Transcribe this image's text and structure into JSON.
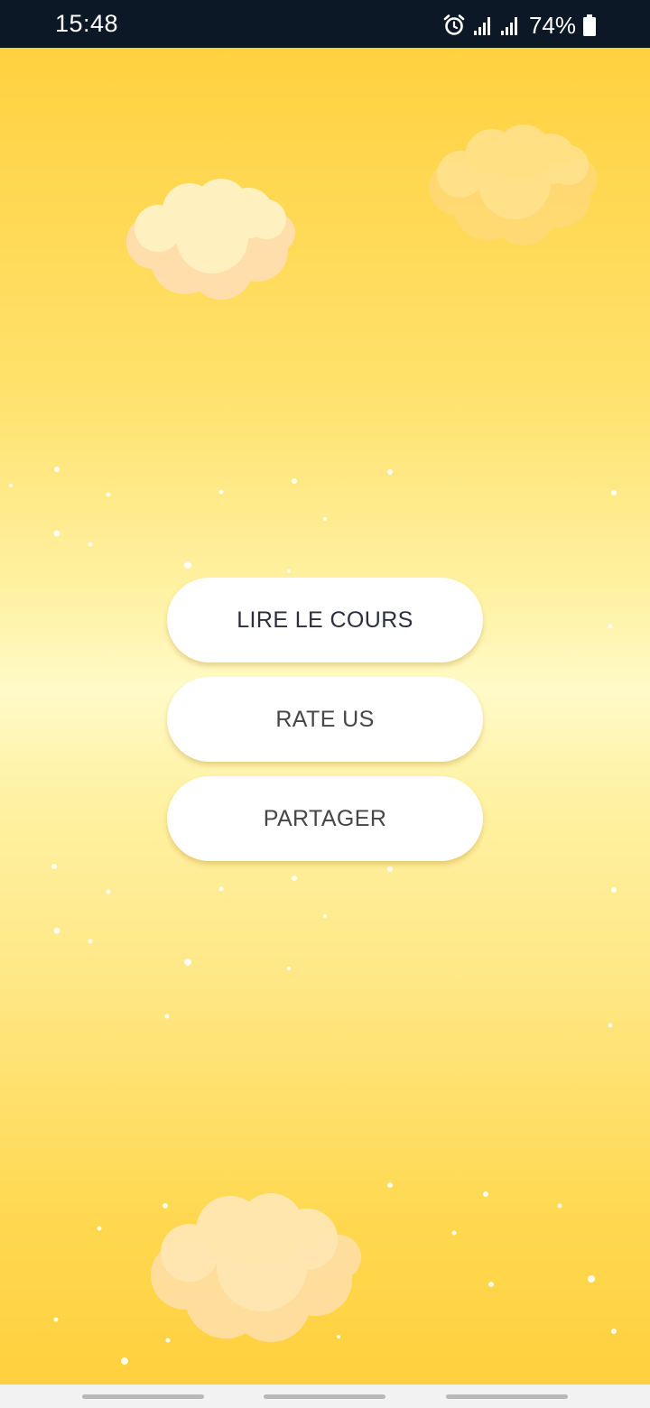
{
  "status_bar": {
    "time": "15:48",
    "battery_percent": "74%",
    "icons": [
      "alarm-icon",
      "signal-icon",
      "signal-icon",
      "battery-icon"
    ]
  },
  "menu": {
    "read_course_label": "LIRE LE COURS",
    "rate_label": "RATE US",
    "share_label": "PARTAGER"
  },
  "navigation_bar": {
    "items": [
      "recent-apps",
      "home",
      "back"
    ]
  },
  "colors": {
    "background_top": "#ffd140",
    "background_middle": "#fffac8",
    "button": "#ffffff",
    "status_bar": "#0d1826"
  }
}
